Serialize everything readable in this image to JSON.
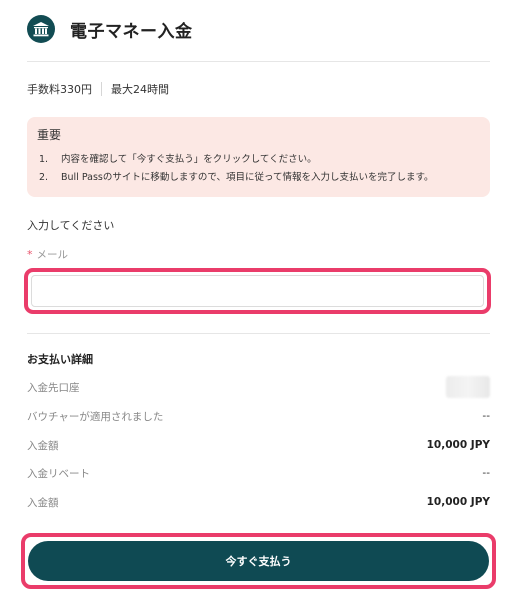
{
  "header": {
    "title": "電子マネー入金"
  },
  "fee": {
    "fee_text": "手数料330円",
    "time_text": "最大24時間"
  },
  "notice": {
    "title": "重要",
    "items": [
      {
        "num": "1.",
        "text": "内容を確認して「今すぐ支払う」をクリックしてください。"
      },
      {
        "num": "2.",
        "text": "Bull Passのサイトに移動しますので、項目に従って情報を入力し支払いを完了します。"
      }
    ]
  },
  "form": {
    "section_label": "入力してください",
    "required_mark": "*",
    "email_label": "メール",
    "email_value": "",
    "email_placeholder": ""
  },
  "details": {
    "title": "お支払い詳細",
    "rows": [
      {
        "label": "入金先口座",
        "value": ""
      },
      {
        "label": "バウチャーが適用されました",
        "value": "--"
      },
      {
        "label": "入金額",
        "value": "10,000 JPY"
      },
      {
        "label": "入金リベート",
        "value": "--"
      },
      {
        "label": "入金額",
        "value": "10,000 JPY"
      }
    ]
  },
  "action": {
    "pay_label": "今すぐ支払う"
  },
  "colors": {
    "brand": "#0f4a53",
    "highlight": "#ea3c6a",
    "notice_bg": "#fce8e4",
    "required": "#e8536b"
  },
  "icons": {
    "header_icon": "bank-icon"
  }
}
